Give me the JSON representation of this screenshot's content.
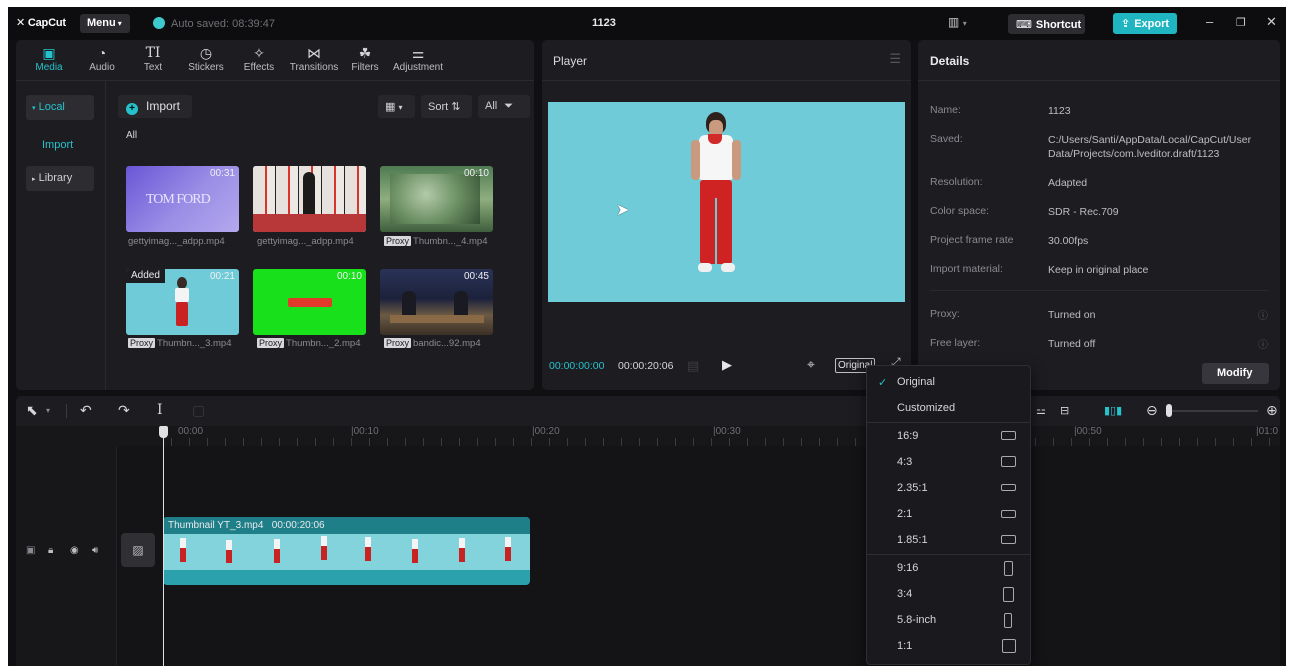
{
  "app": {
    "logo": "CapCut",
    "menu_label": "Menu",
    "autosave": "Auto saved: 08:39:47",
    "project_title": "1123",
    "shortcut_label": "Shortcut",
    "export_label": "Export"
  },
  "media_tools": [
    {
      "label": "Media",
      "icon": "media-icon"
    },
    {
      "label": "Audio",
      "icon": "audio-icon"
    },
    {
      "label": "Text",
      "icon": "text-icon"
    },
    {
      "label": "Stickers",
      "icon": "stickers-icon"
    },
    {
      "label": "Effects",
      "icon": "effects-icon"
    },
    {
      "label": "Transitions",
      "icon": "transitions-icon"
    },
    {
      "label": "Filters",
      "icon": "filters-icon"
    },
    {
      "label": "Adjustment",
      "icon": "adjustment-icon"
    }
  ],
  "sidebar": {
    "local": "Local",
    "import": "Import",
    "library": "Library"
  },
  "media": {
    "import_label": "Import",
    "sort_label": "Sort",
    "all_filter_label": "All",
    "all_heading": "All",
    "items": [
      {
        "name": "gettyimag..._adpp.mp4",
        "duration": "00:31",
        "proxy": false,
        "added": false
      },
      {
        "name": "gettyimag..._adpp.mp4",
        "duration": "",
        "proxy": false,
        "added": false
      },
      {
        "name": "Thumbn..._4.mp4",
        "duration": "00:10",
        "proxy": true,
        "added": false
      },
      {
        "name": "Thumbn..._3.mp4",
        "duration": "00:21",
        "proxy": true,
        "added": true
      },
      {
        "name": "Thumbn..._2.mp4",
        "duration": "00:10",
        "proxy": true,
        "added": false
      },
      {
        "name": "bandic...92.mp4",
        "duration": "00:45",
        "proxy": true,
        "added": false
      }
    ],
    "proxy_tag": "Proxy",
    "added_tag": "Added",
    "thumb1_text": "TOM FORD"
  },
  "player": {
    "title": "Player",
    "current_time": "00:00:00:00",
    "total_time": "00:00:20:06",
    "ratio_label": "Original"
  },
  "details": {
    "title": "Details",
    "rows": [
      {
        "label": "Name:",
        "value": "1123"
      },
      {
        "label": "Saved:",
        "value": "C:/Users/Santi/AppData/Local/CapCut/User Data/Projects/com.lveditor.draft/1123"
      },
      {
        "label": "Resolution:",
        "value": "Adapted"
      },
      {
        "label": "Color space:",
        "value": "SDR - Rec.709"
      },
      {
        "label": "Project frame rate",
        "value": "30.00fps"
      },
      {
        "label": "Import material:",
        "value": "Keep in original place"
      },
      {
        "label": "Proxy:",
        "value": "Turned on"
      },
      {
        "label": "Free layer:",
        "value": "Turned off"
      }
    ],
    "modify_label": "Modify"
  },
  "timeline": {
    "ruler": [
      "00:00",
      "00:10",
      "00:20",
      "00:30",
      "00:50",
      "01:0"
    ],
    "clip_name": "Thumbnail YT_3.mp4",
    "clip_duration": "00:00:20:06"
  },
  "ratio_menu": {
    "items": [
      {
        "label": "Original",
        "checked": true,
        "shape": "none"
      },
      {
        "label": "Customized",
        "checked": false,
        "shape": "none"
      },
      {
        "label": "16:9",
        "checked": false,
        "shape": "wide"
      },
      {
        "label": "4:3",
        "checked": false,
        "shape": "standard"
      },
      {
        "label": "2.35:1",
        "checked": false,
        "shape": "cinema"
      },
      {
        "label": "2:1",
        "checked": false,
        "shape": "wide2"
      },
      {
        "label": "1.85:1",
        "checked": false,
        "shape": "wide185"
      },
      {
        "label": "9:16",
        "checked": false,
        "shape": "tall"
      },
      {
        "label": "3:4",
        "checked": false,
        "shape": "portrait"
      },
      {
        "label": "5.8-inch",
        "checked": false,
        "shape": "phone"
      },
      {
        "label": "1:1",
        "checked": false,
        "shape": "square"
      }
    ]
  },
  "colors": {
    "accent": "#25c2cc",
    "video_bg": "#6ecbd7",
    "clip": "#2aa1ad"
  }
}
